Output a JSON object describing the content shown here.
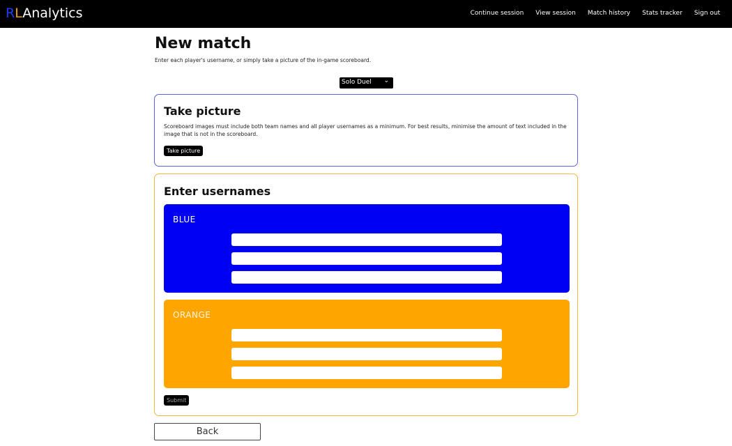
{
  "nav": {
    "brand_r": "R",
    "brand_l": "L",
    "brand_rest": "Analytics",
    "links": [
      "Continue session",
      "View session",
      "Match history",
      "Stats tracker",
      "Sign out"
    ]
  },
  "page": {
    "title": "New match",
    "subtitle": "Enter each player's username, or simply take a picture of the in-game scoreboard."
  },
  "mode_select": {
    "value": "Solo Duel"
  },
  "take_picture": {
    "title": "Take picture",
    "description": "Scoreboard images must include both team names and all player usernames as a minimum. For best results, minimise the amount of text included in the image that is not in the scoreboard.",
    "button_label": "Take picture"
  },
  "usernames": {
    "title": "Enter usernames",
    "blue_label": "BLUE",
    "orange_label": "ORANGE",
    "submit_label": "Submit"
  },
  "back_label": "Back",
  "colors": {
    "nav_bg": "#000000",
    "brand_r": "#1f3dff",
    "brand_l": "#ffa500",
    "blue_team": "#0000f5",
    "orange_team": "#ffa500",
    "picture_border": "#5b63e8",
    "usernames_border": "#f3b83c"
  }
}
